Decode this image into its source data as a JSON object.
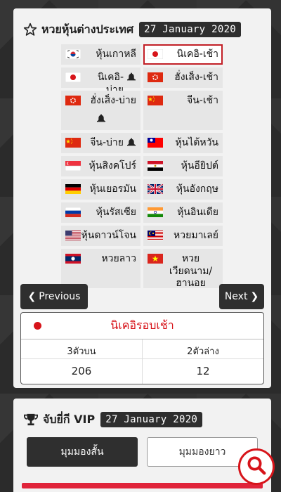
{
  "section1": {
    "title": "หวยหุ้นต่างประเทศ",
    "date": "27 January 2020",
    "items": [
      {
        "label": "หุ้นเกาหลี",
        "flag": "korea-flag"
      },
      {
        "label": "นิเคอิ-เช้า",
        "flag": "japan-flag",
        "active": true
      },
      {
        "label": "นิเคอิ-บ่าย",
        "flag": "japan-flag",
        "bell": true
      },
      {
        "label": "ฮั่งเส็ง-เช้า",
        "flag": "hongkong-flag"
      },
      {
        "label": "ฮั่งเส็ง-บ่าย",
        "flag": "hongkong-flag",
        "bell": true
      },
      {
        "label": "จีน-เช้า",
        "flag": "china-flag"
      },
      {
        "label": "จีน-บ่าย",
        "flag": "china-flag",
        "bell": true
      },
      {
        "label": "หุ้นไต้หวัน",
        "flag": "taiwan-flag"
      },
      {
        "label": "หุ้นสิงคโปร์",
        "flag": "singapore-flag"
      },
      {
        "label": "หุ้นอียิปต์",
        "flag": "egypt-flag"
      },
      {
        "label": "หุ้นเยอรมัน",
        "flag": "germany-flag"
      },
      {
        "label": "หุ้นอังกฤษ",
        "flag": "uk-flag"
      },
      {
        "label": "หุ้นรัสเซีย",
        "flag": "russia-flag"
      },
      {
        "label": "หุ้นอินเดีย",
        "flag": "india-flag"
      },
      {
        "label": "หุ้นดาวน์โจน",
        "flag": "usa-flag"
      },
      {
        "label": "หวยมาเลย์",
        "flag": "malaysia-flag"
      },
      {
        "label": "หวยลาว",
        "flag": "laos-flag"
      },
      {
        "label": "หวย\nเวียดนาม/ฮานอย",
        "flag": "vietnam-flag"
      }
    ],
    "prev_label": "Previous",
    "next_label": "Next",
    "result": {
      "title": "นิเคอิรอบเช้า",
      "col1_label": "3ตัวบน",
      "col1_value": "206",
      "col2_label": "2ตัวล่าง",
      "col2_value": "12"
    }
  },
  "section2": {
    "title": "จับยี่กี VIP",
    "date": "27 January 2020",
    "tab_short": "มุมมองสั้น",
    "tab_long": "มุมมองยาว"
  },
  "colors": {
    "accent": "#d7141a",
    "dark": "#2f2f2f",
    "panel": "#f2f2f2"
  }
}
